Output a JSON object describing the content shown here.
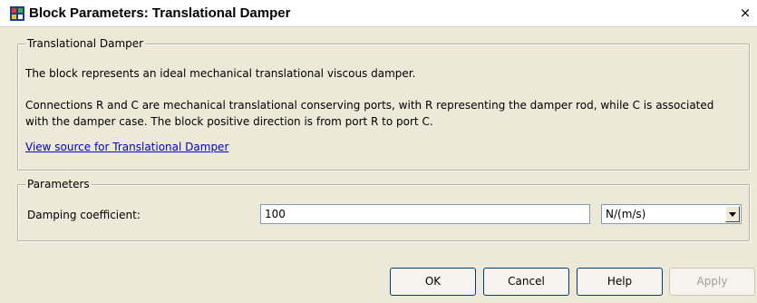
{
  "window": {
    "title": "Block Parameters: Translational Damper",
    "close_glyph": "×"
  },
  "description": {
    "legend": "Translational Damper",
    "line1": "The block represents an ideal mechanical translational viscous damper.",
    "line2": "Connections R and C are mechanical translational conserving ports, with R representing the damper rod, while C is associated",
    "line3": "with the damper case. The block positive direction is from port R to port C.",
    "link": "View source for Translational Damper"
  },
  "parameters": {
    "legend": "Parameters",
    "damping_label": "Damping coefficient:",
    "damping_value": "100",
    "damping_unit": "N/(m/s)"
  },
  "buttons": {
    "ok": "OK",
    "cancel": "Cancel",
    "help": "Help",
    "apply": "Apply"
  },
  "icons": {
    "app": "simulink-block-icon",
    "dropdown": "chevron-down-icon"
  }
}
